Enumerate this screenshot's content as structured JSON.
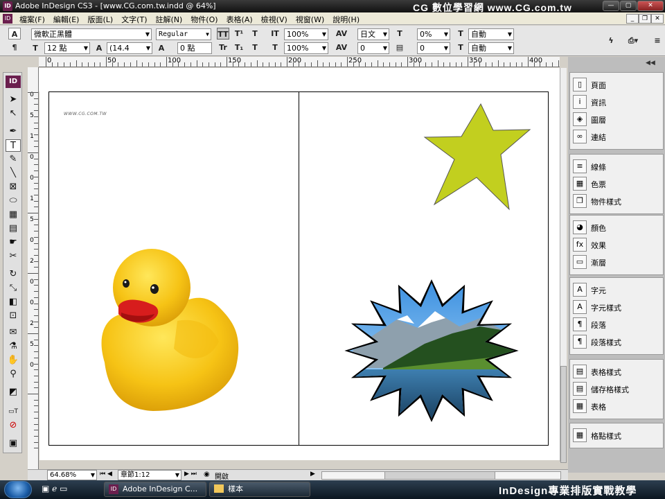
{
  "window": {
    "title": "Adobe InDesign CS3 - [www.CG.com.tw.indd @ 64%]",
    "watermark": "CG 數位學習網 www.CG.com.tw",
    "logo": "ID"
  },
  "menu": [
    "檔案(F)",
    "編輯(E)",
    "版面(L)",
    "文字(T)",
    "註解(N)",
    "物件(O)",
    "表格(A)",
    "檢視(V)",
    "視窗(W)",
    "說明(H)"
  ],
  "control": {
    "font": "微軟正黑體",
    "style": "Regular",
    "size": "12 點",
    "leading": "(14.4",
    "baseline": "0 點",
    "hscale": "100%",
    "vscale": "100%",
    "lang": "日文",
    "track": "0",
    "kern": "0",
    "tsume": "0%",
    "aki": "0",
    "mojikumi1": "自動",
    "mojikumi2": "自動"
  },
  "ruler": {
    "top": [
      "0",
      "50",
      "100",
      "150",
      "200",
      "250",
      "300",
      "350",
      "400"
    ],
    "left": [
      "0",
      "5",
      "1",
      "0",
      "0",
      "1",
      "5",
      "0",
      "2",
      "0",
      "0",
      "2",
      "5",
      "0"
    ]
  },
  "page": {
    "url_text": "WWW.CG.COM.TW"
  },
  "panel": {
    "groups": [
      {
        "items": [
          {
            "icon": "pages-icon",
            "label": "頁面",
            "glyph": "▯"
          },
          {
            "icon": "info-icon",
            "label": "資訊",
            "glyph": "i"
          },
          {
            "icon": "layers-icon",
            "label": "圖層",
            "glyph": "◈"
          },
          {
            "icon": "links-icon",
            "label": "連結",
            "glyph": "∞"
          }
        ]
      },
      {
        "items": [
          {
            "icon": "stroke-icon",
            "label": "線條",
            "glyph": "≡"
          },
          {
            "icon": "swatches-icon",
            "label": "色票",
            "glyph": "▦"
          },
          {
            "icon": "object-styles-icon",
            "label": "物件樣式",
            "glyph": "❐"
          }
        ]
      },
      {
        "items": [
          {
            "icon": "color-icon",
            "label": "顏色",
            "glyph": "◕"
          },
          {
            "icon": "effects-icon",
            "label": "效果",
            "glyph": "fx"
          },
          {
            "icon": "gradient-icon",
            "label": "漸層",
            "glyph": "▭"
          }
        ]
      },
      {
        "items": [
          {
            "icon": "character-icon",
            "label": "字元",
            "glyph": "A"
          },
          {
            "icon": "character-styles-icon",
            "label": "字元樣式",
            "glyph": "A"
          },
          {
            "icon": "paragraph-icon",
            "label": "段落",
            "glyph": "¶"
          },
          {
            "icon": "paragraph-styles-icon",
            "label": "段落樣式",
            "glyph": "¶"
          }
        ]
      },
      {
        "items": [
          {
            "icon": "table-styles-icon",
            "label": "表格樣式",
            "glyph": "▤"
          },
          {
            "icon": "cell-styles-icon",
            "label": "儲存格樣式",
            "glyph": "▤"
          },
          {
            "icon": "table-icon",
            "label": "表格",
            "glyph": "▦"
          }
        ]
      },
      {
        "items": [
          {
            "icon": "grid-styles-icon",
            "label": "格點樣式",
            "glyph": "▦"
          }
        ]
      }
    ]
  },
  "status": {
    "zoom": "64.68%",
    "page": "章節1:12",
    "state": "開啟"
  },
  "taskbar": {
    "app": "Adobe InDesign C...",
    "folder": "樣本",
    "brand": "InDesign專業排版實戰教學"
  }
}
